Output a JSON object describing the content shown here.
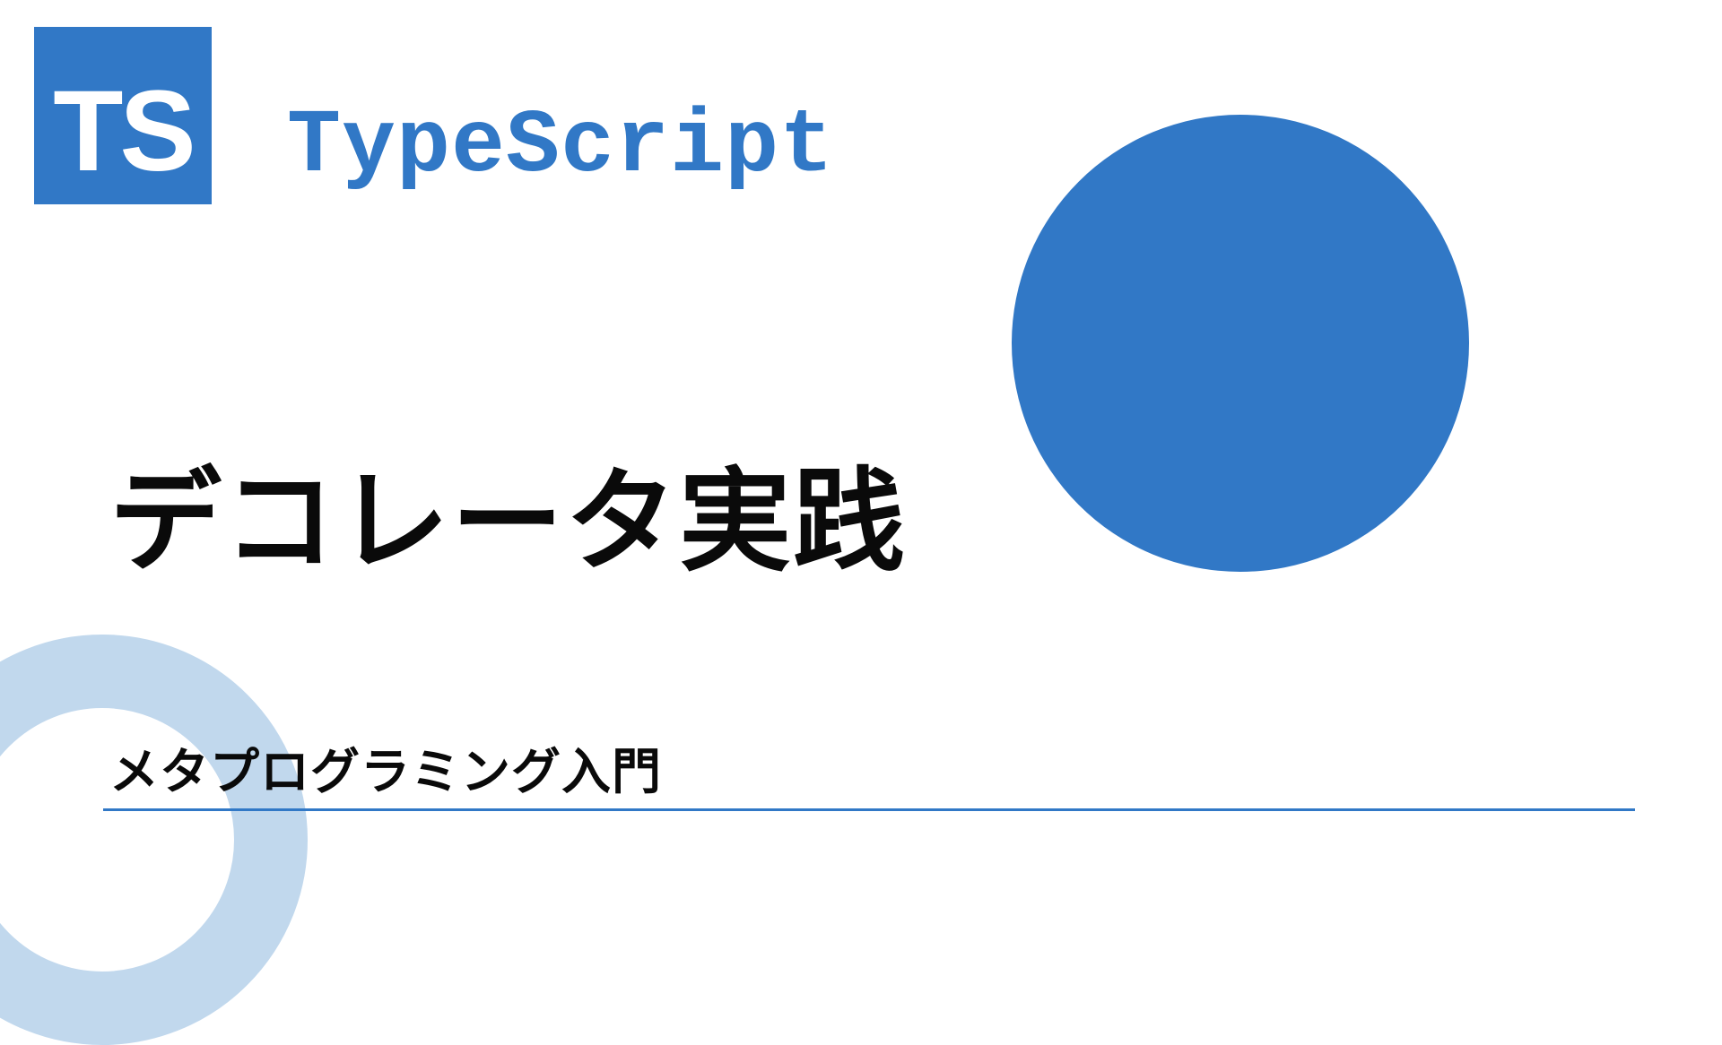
{
  "logo": {
    "text": "TS"
  },
  "brand": "TypeScript",
  "title": "デコレータ実践",
  "subtitle": "メタプログラミング入門",
  "colors": {
    "primary": "#3178c6",
    "ring": "#c1d8ed",
    "text": "#0a0a0a"
  }
}
